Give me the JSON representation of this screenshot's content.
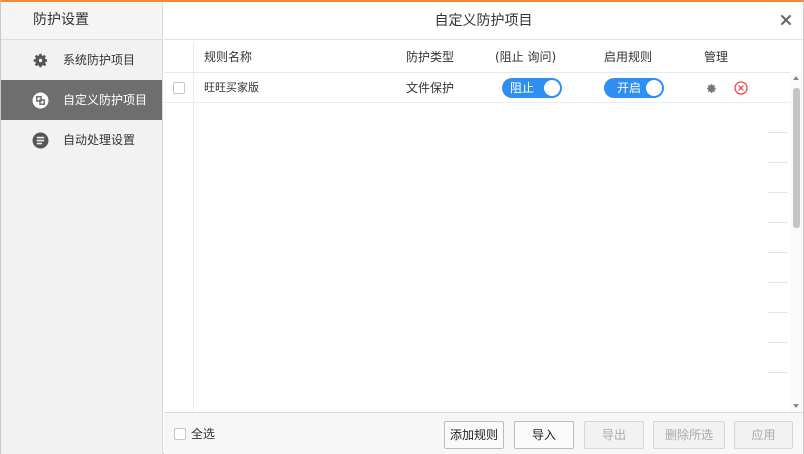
{
  "sidebar": {
    "title": "防护设置",
    "items": [
      {
        "label": "系统防护项目",
        "icon": "gear-icon",
        "active": false
      },
      {
        "label": "自定义防护项目",
        "icon": "shield-icon",
        "active": true
      },
      {
        "label": "自动处理设置",
        "icon": "list-icon",
        "active": false
      }
    ]
  },
  "titlebar": {
    "title": "自定义防护项目",
    "close_glyph": "×"
  },
  "table": {
    "headers": {
      "name": "规则名称",
      "type": "防护类型",
      "action": "(阻止  询问)",
      "enable": "启用规则",
      "manage": "管理"
    },
    "rows": [
      {
        "name": "旺旺买家版",
        "type": "文件保护",
        "action": "阻止",
        "enable": "开启"
      }
    ]
  },
  "footer": {
    "select_all": "全选",
    "buttons": {
      "add": "添加规则",
      "import": "导入",
      "export": "导出",
      "delete": "删除所选",
      "apply": "应用"
    }
  },
  "colors": {
    "accent": "#2f8ff0",
    "active_sidebar": "#6e6e6e",
    "top_border": "#f0883a",
    "delete": "#e84a55"
  }
}
